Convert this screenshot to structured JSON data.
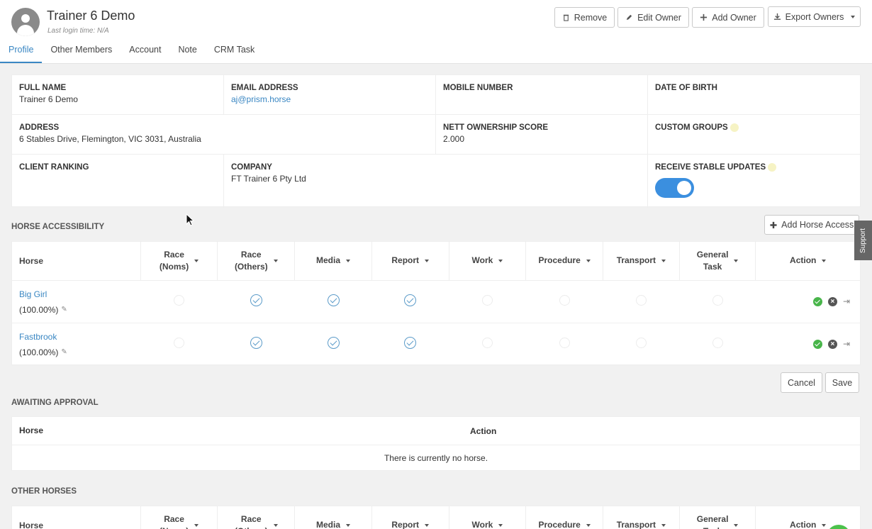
{
  "header": {
    "title": "Trainer 6 Demo",
    "last_login": "Last login time: N/A",
    "buttons": {
      "remove": "Remove",
      "edit_owner": "Edit Owner",
      "add_owner": "Add Owner",
      "export_owners": "Export Owners"
    }
  },
  "tabs": [
    "Profile",
    "Other Members",
    "Account",
    "Note",
    "CRM Task"
  ],
  "profile": {
    "full_name_label": "FULL NAME",
    "full_name": "Trainer 6 Demo",
    "email_label": "EMAIL ADDRESS",
    "email": "aj@prism.horse",
    "mobile_label": "MOBILE NUMBER",
    "dob_label": "DATE OF BIRTH",
    "address_label": "ADDRESS",
    "address": "6 Stables Drive, Flemington, VIC 3031, Australia",
    "nett_label": "NETT OWNERSHIP SCORE",
    "nett": "2.000",
    "custom_groups_label": "CUSTOM GROUPS",
    "client_ranking_label": "CLIENT RANKING",
    "company_label": "COMPANY",
    "company": "FT Trainer 6 Pty Ltd",
    "stable_updates_label": "RECEIVE STABLE UPDATES",
    "stable_updates_on": true
  },
  "horse_access": {
    "title": "HORSE ACCESSIBILITY",
    "add_button": "Add Horse Access",
    "columns": {
      "horse": "Horse",
      "race_noms_1": "Race",
      "race_noms_2": "(Noms)",
      "race_others_1": "Race",
      "race_others_2": "(Others)",
      "media": "Media",
      "report": "Report",
      "work": "Work",
      "procedure": "Procedure",
      "transport": "Transport",
      "general_1": "General",
      "general_2": "Task",
      "action": "Action"
    },
    "rows": [
      {
        "name": "Big Girl",
        "pct": "(100.00%)"
      },
      {
        "name": "Fastbrook",
        "pct": "(100.00%)"
      }
    ],
    "cancel": "Cancel",
    "save": "Save"
  },
  "awaiting": {
    "title": "AWAITING APPROVAL",
    "horse_col": "Horse",
    "action_col": "Action",
    "empty": "There is currently no horse."
  },
  "other_horses": {
    "title": "OTHER HORSES"
  },
  "support": "Support"
}
